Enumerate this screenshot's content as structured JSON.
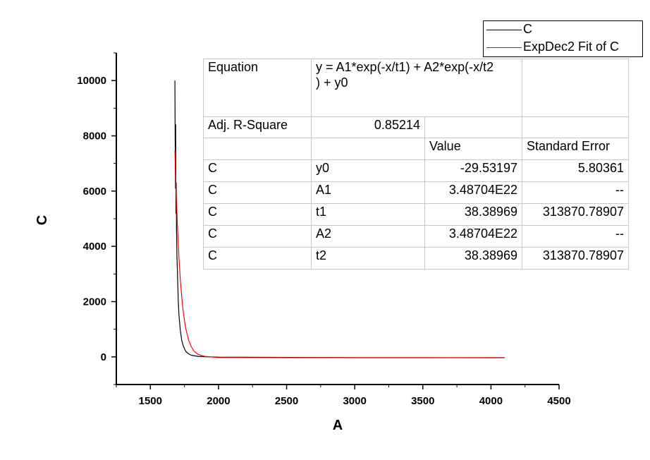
{
  "chart_data": {
    "type": "line",
    "xlabel": "A",
    "ylabel": "C",
    "xlim": [
      1250,
      4500
    ],
    "ylim": [
      -1000,
      11000
    ],
    "x_ticks": [
      "1500",
      "2000",
      "2500",
      "3000",
      "3500",
      "4000",
      "4500"
    ],
    "y_ticks": [
      "0",
      "2000",
      "4000",
      "6000",
      "8000",
      "10000"
    ],
    "series": [
      {
        "name": "C",
        "color": "#000000",
        "x": [
          1680,
          1682,
          1684,
          1686,
          1688,
          1690,
          1692,
          1695,
          1700,
          1705,
          1710,
          1720,
          1730,
          1740,
          1750,
          1760,
          1780,
          1800,
          1850,
          1900,
          2000,
          2500,
          3000,
          3500,
          4000,
          4100
        ],
        "y": [
          10000,
          7600,
          6100,
          8400,
          5200,
          6300,
          4600,
          3600,
          2800,
          2000,
          1500,
          950,
          600,
          420,
          300,
          200,
          110,
          60,
          20,
          5,
          -10,
          -20,
          -25,
          -28,
          -30,
          -30
        ]
      },
      {
        "name": "ExpDec2 Fit of C",
        "color": "#ff0000",
        "x": [
          1680,
          1690,
          1700,
          1710,
          1720,
          1730,
          1740,
          1750,
          1760,
          1780,
          1800,
          1820,
          1850,
          1900,
          2000,
          2500,
          3000,
          3500,
          4000,
          4100
        ],
        "y": [
          7450,
          5830,
          4550,
          3560,
          2780,
          2170,
          1690,
          1320,
          1030,
          620,
          370,
          215,
          90,
          15,
          -25,
          -29.5,
          -29.5,
          -29.5,
          -29.5,
          -29.5
        ]
      }
    ],
    "legend": {
      "position": "top-right",
      "entries": [
        "C",
        "ExpDec2 Fit of C"
      ]
    },
    "fit_table": {
      "equation_label": "Equation",
      "equation_line1": "y = A1*exp(-x/t1) + A2*exp(-x/t2",
      "equation_line2": ") + y0",
      "adj_r_label": "Adj. R-Square",
      "adj_r_value": "0.85214",
      "col_value": "Value",
      "col_error": "Standard Error",
      "rows": [
        {
          "dep": "C",
          "param": "y0",
          "value": "-29.53197",
          "error": "5.80361"
        },
        {
          "dep": "C",
          "param": "A1",
          "value": "3.48704E22",
          "error": "--"
        },
        {
          "dep": "C",
          "param": "t1",
          "value": "38.38969",
          "error": "313870.78907"
        },
        {
          "dep": "C",
          "param": "A2",
          "value": "3.48704E22",
          "error": "--"
        },
        {
          "dep": "C",
          "param": "t2",
          "value": "38.38969",
          "error": "313870.78907"
        }
      ]
    }
  }
}
